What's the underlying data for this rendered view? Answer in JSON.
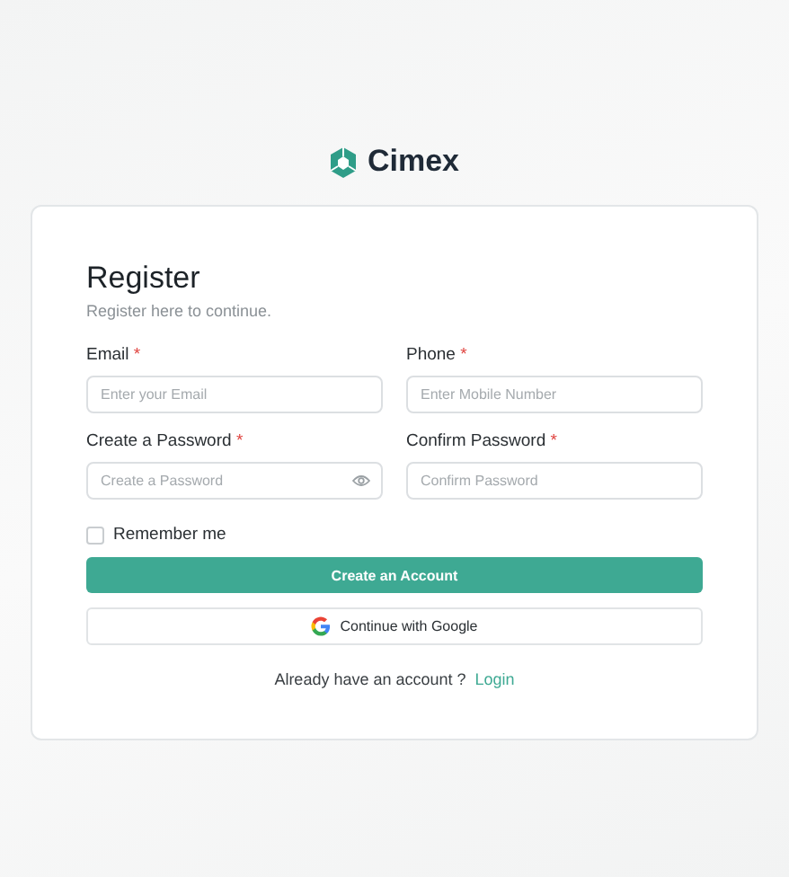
{
  "brand": "Cimex",
  "title": "Register",
  "subtitle": "Register here to continue.",
  "fields": [
    {
      "label": "Email",
      "mark": "*",
      "placeholder": "Enter your Email",
      "reveal": false
    },
    {
      "label": "Phone",
      "mark": "*",
      "placeholder": "Enter Mobile Number",
      "reveal": false
    },
    {
      "label": "Create a Password",
      "mark": "*",
      "placeholder": "Create a Password",
      "reveal": true
    },
    {
      "label": "Confirm Password",
      "mark": "*",
      "placeholder": "Confirm Password",
      "reveal": false
    }
  ],
  "remember": {
    "label": "Remember me",
    "checked": false
  },
  "submit": "Create an Account",
  "google": "Continue with Google",
  "footer": {
    "text": "Already have an account ?",
    "link": "Login"
  }
}
